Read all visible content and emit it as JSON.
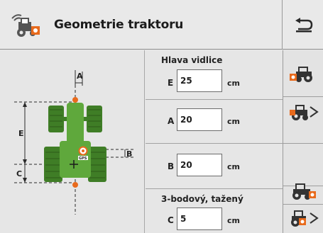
{
  "header": {
    "title": "Geometrie traktoru",
    "app_icon": "tractor-settings-icon",
    "back_icon": "return-arrow-icon"
  },
  "diagram": {
    "labels": {
      "a": "A",
      "b": "B",
      "c": "C",
      "e": "E"
    },
    "gps_label": "GPS",
    "colors": {
      "tractor": "#5fa83c",
      "tractor_dark": "#3f7d26",
      "marker": "#e86a1c",
      "line": "#2b2b2b"
    }
  },
  "fields": {
    "hitch": {
      "section_label": "Hlava vidlice",
      "letter": "E",
      "value": "25",
      "unit": "cm"
    },
    "a": {
      "letter": "A",
      "value": "20",
      "unit": "cm"
    },
    "b": {
      "letter": "B",
      "value": "20",
      "unit": "cm"
    },
    "three_point": {
      "section_label": "3-bodový, tažený",
      "letter": "C",
      "value": "5",
      "unit": "cm"
    }
  },
  "sidebar": {
    "buttons": [
      {
        "icon": "tractor-front-icon"
      },
      {
        "icon": "tractor-next-icon"
      },
      {
        "icon": ""
      },
      {
        "icon": "tractor-rear-icon"
      },
      {
        "icon": "tractor-rear-next-icon"
      }
    ]
  }
}
